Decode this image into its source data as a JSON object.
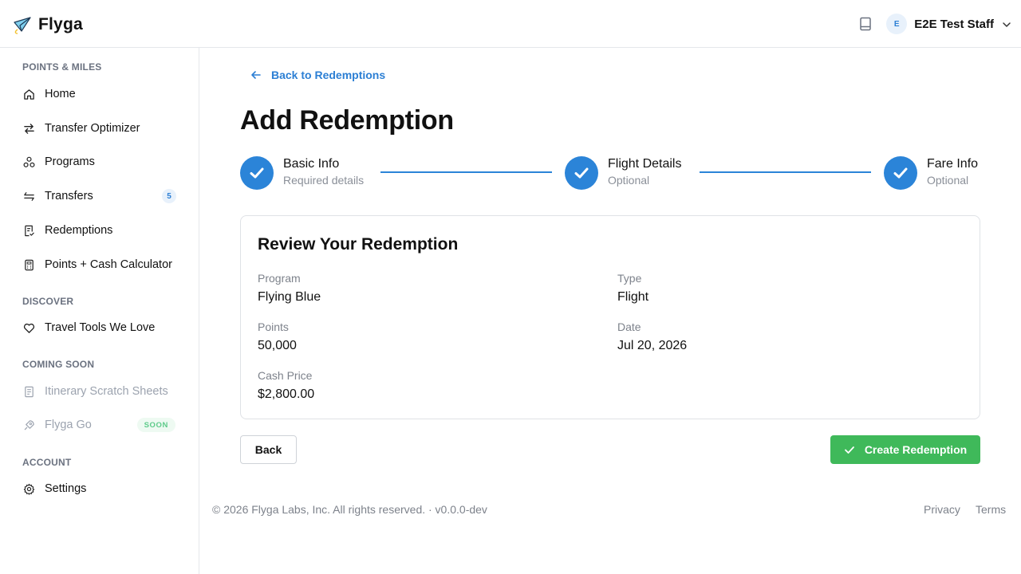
{
  "brand": {
    "name": "Flyga",
    "logo_icon": "paper-plane-icon"
  },
  "header": {
    "avatar_initial": "E",
    "user_name": "E2E Test Staff",
    "book_icon": "book-icon"
  },
  "sidebar": {
    "sections": [
      {
        "label": "POINTS & MILES"
      },
      {
        "label": "DISCOVER"
      },
      {
        "label": "COMING SOON"
      },
      {
        "label": "ACCOUNT"
      }
    ],
    "items": [
      {
        "label": "Home",
        "icon": "home-icon"
      },
      {
        "label": "Transfer Optimizer",
        "icon": "swap-icon"
      },
      {
        "label": "Programs",
        "icon": "programs-icon"
      },
      {
        "label": "Transfers",
        "icon": "transfers-icon",
        "badge": "5"
      },
      {
        "label": "Redemptions",
        "icon": "receipt-icon"
      },
      {
        "label": "Points + Cash Calculator",
        "icon": "calculator-icon"
      },
      {
        "label": "Travel Tools We Love",
        "icon": "heart-icon"
      },
      {
        "label": "Itinerary Scratch Sheets",
        "icon": "sheet-icon"
      },
      {
        "label": "Flyga Go",
        "icon": "rocket-icon",
        "tag": "SOON"
      },
      {
        "label": "Settings",
        "icon": "gear-icon"
      }
    ]
  },
  "main": {
    "back_link": "Back to Redemptions",
    "title": "Add Redemption",
    "steps": [
      {
        "title": "Basic Info",
        "subtitle": "Required details"
      },
      {
        "title": "Flight Details",
        "subtitle": "Optional"
      },
      {
        "title": "Fare Info",
        "subtitle": "Optional"
      }
    ],
    "review": {
      "title": "Review Your Redemption",
      "fields": [
        {
          "label": "Program",
          "value": "Flying Blue"
        },
        {
          "label": "Type",
          "value": "Flight"
        },
        {
          "label": "Points",
          "value": "50,000"
        },
        {
          "label": "Date",
          "value": "Jul 20, 2026"
        },
        {
          "label": "Cash Price",
          "value": "$2,800.00"
        }
      ]
    },
    "back_button": "Back",
    "create_button": "Create Redemption"
  },
  "footer": {
    "copyright": "© 2026 Flyga Labs, Inc. All rights reserved. · v0.0.0-dev",
    "privacy": "Privacy",
    "terms": "Terms"
  },
  "colors": {
    "accent": "#2b84d8",
    "success": "#3fb95a",
    "muted": "#7d828b"
  }
}
